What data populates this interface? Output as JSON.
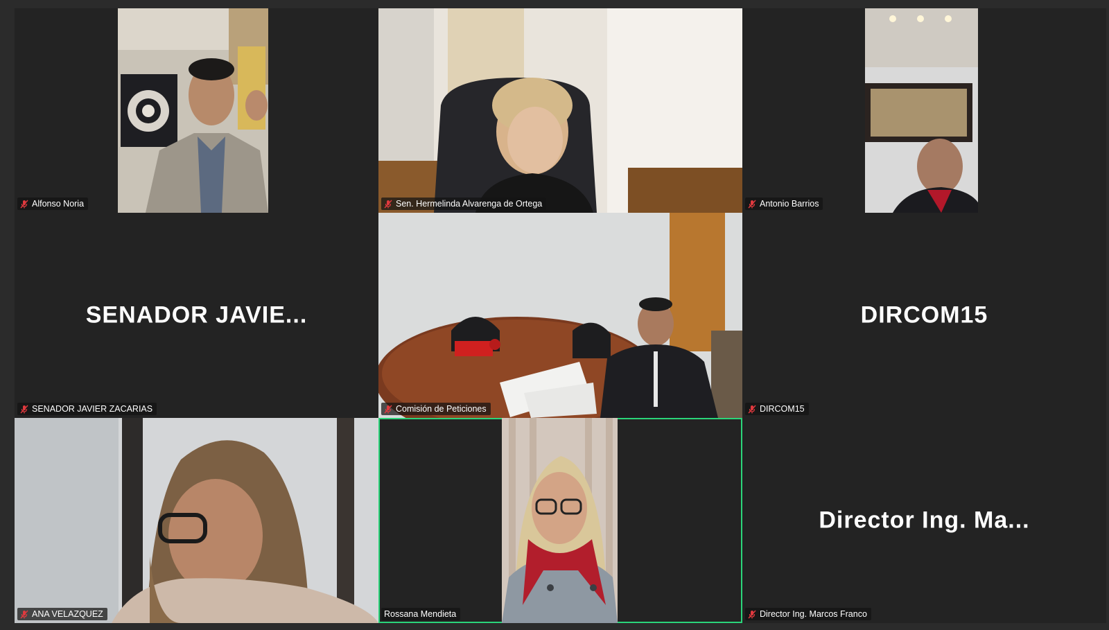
{
  "tiles": [
    {
      "name": "Alfonso Noria",
      "muted": true,
      "has_video": true,
      "placeholder": ""
    },
    {
      "name": "Sen. Hermelinda Alvarenga de Ortega",
      "muted": true,
      "has_video": true,
      "placeholder": ""
    },
    {
      "name": "Antonio Barrios",
      "muted": true,
      "has_video": true,
      "placeholder": ""
    },
    {
      "name": "SENADOR JAVIER ZACARIAS",
      "muted": true,
      "has_video": false,
      "placeholder": "SENADOR  JAVIE..."
    },
    {
      "name": "Comisión de Peticiones",
      "muted": true,
      "has_video": true,
      "placeholder": ""
    },
    {
      "name": "DIRCOM15",
      "muted": true,
      "has_video": false,
      "placeholder": "DIRCOM15"
    },
    {
      "name": "ANA  VELAZQUEZ",
      "muted": true,
      "has_video": true,
      "placeholder": ""
    },
    {
      "name": "Rossana Mendieta",
      "muted": false,
      "has_video": true,
      "placeholder": ""
    },
    {
      "name": "Director Ing. Marcos Franco",
      "muted": true,
      "has_video": false,
      "placeholder": "Director  Ing.  Ma..."
    }
  ],
  "colors": {
    "background": "#2b2b2b",
    "tile_background": "#232323",
    "active_speaker_border": "#2bd57a",
    "muted_icon": "#e0393e"
  },
  "icons": {
    "muted": "microphone-muted-icon"
  }
}
